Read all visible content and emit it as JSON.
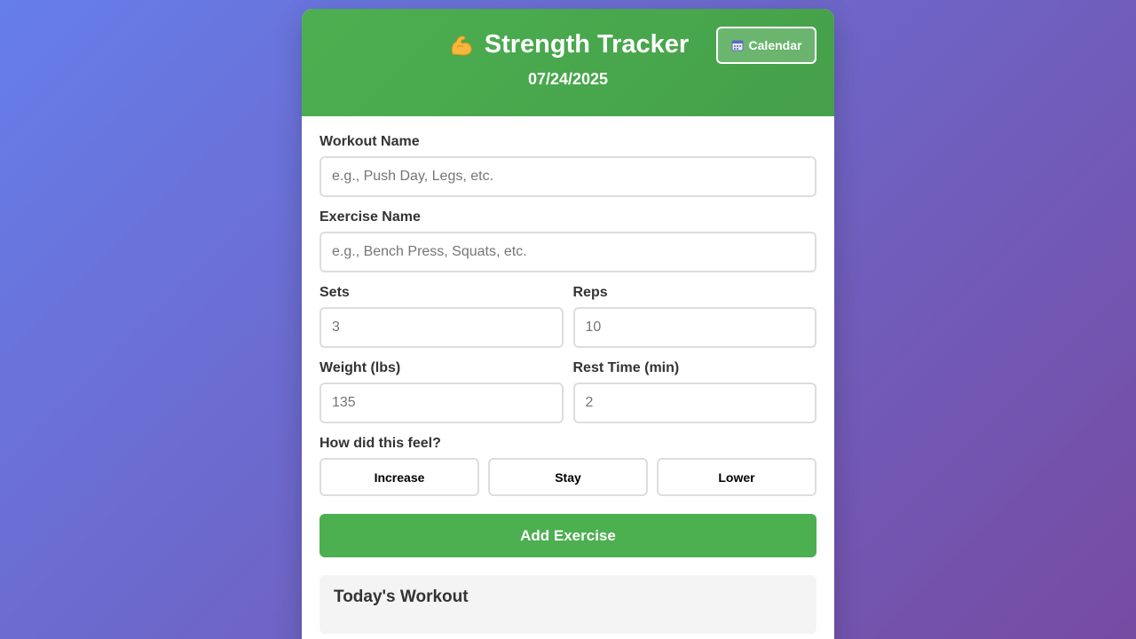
{
  "header": {
    "title": "Strength Tracker",
    "date": "07/24/2025",
    "calendar_label": "Calendar",
    "color": "#4caf50"
  },
  "form": {
    "workout_name": {
      "label": "Workout Name",
      "placeholder": "e.g., Push Day, Legs, etc."
    },
    "exercise_name": {
      "label": "Exercise Name",
      "placeholder": "e.g., Bench Press, Squats, etc."
    },
    "sets": {
      "label": "Sets",
      "placeholder": "3"
    },
    "reps": {
      "label": "Reps",
      "placeholder": "10"
    },
    "weight": {
      "label": "Weight (lbs)",
      "placeholder": "135"
    },
    "rest": {
      "label": "Rest Time (min)",
      "placeholder": "2"
    },
    "feel": {
      "label": "How did this feel?",
      "options": [
        "Increase",
        "Stay",
        "Lower"
      ]
    },
    "add_label": "Add Exercise"
  },
  "today": {
    "title": "Today's Workout"
  },
  "icons": {
    "title_icon": "flexed-biceps-icon",
    "calendar_icon": "calendar-icon"
  }
}
